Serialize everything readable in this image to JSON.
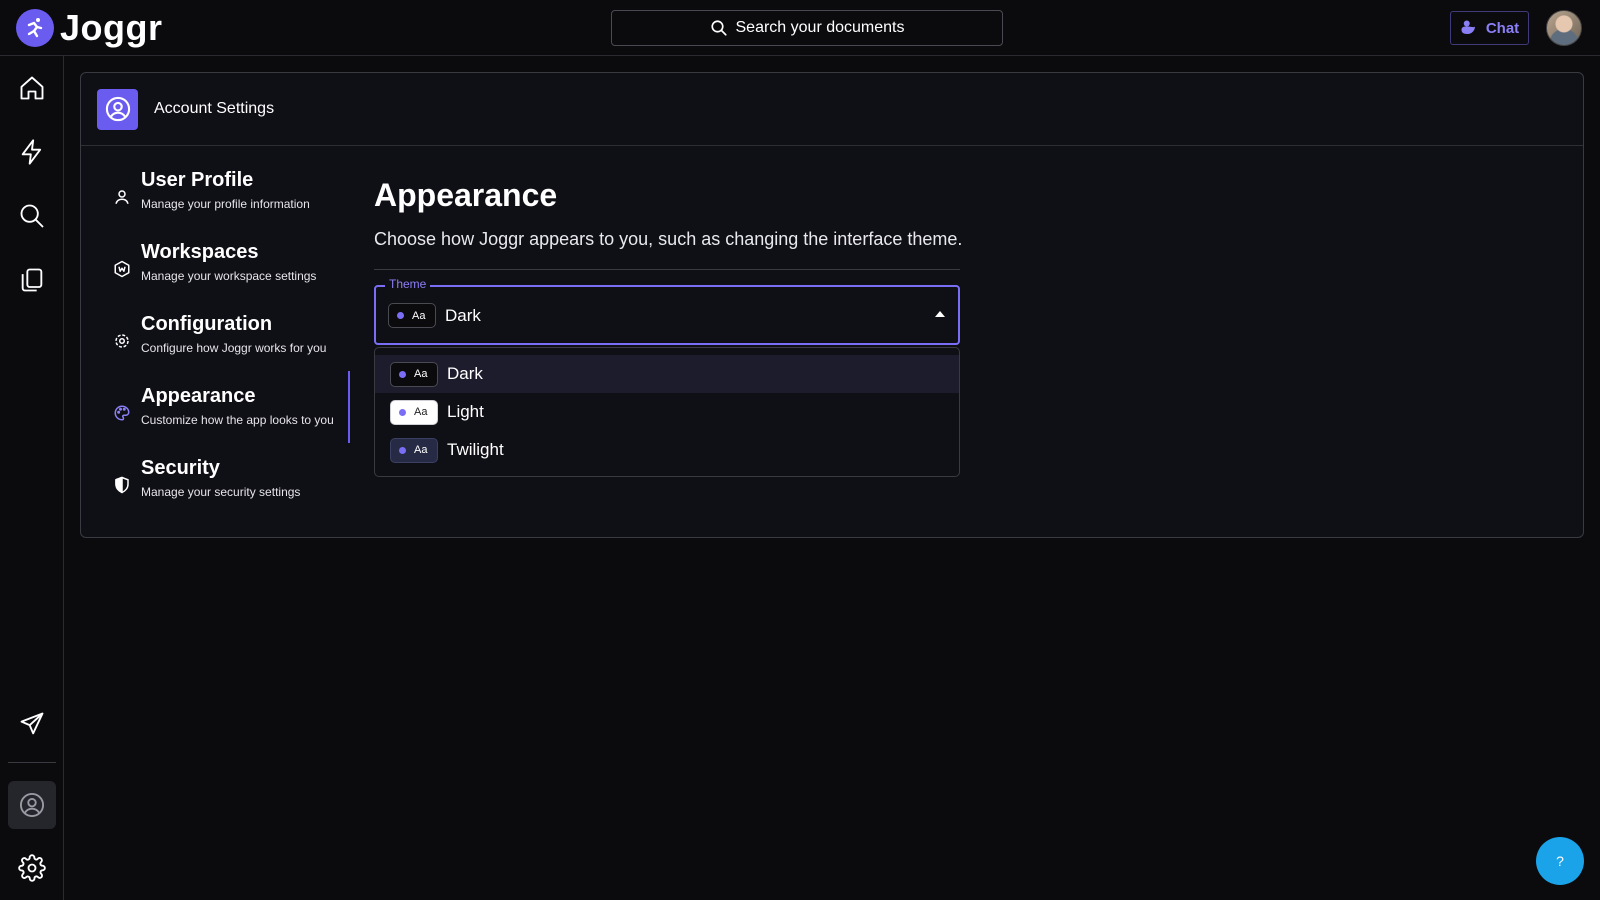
{
  "app": {
    "name": "Joggr"
  },
  "search": {
    "placeholder": "Search your documents"
  },
  "header": {
    "chat_label": "Chat"
  },
  "rail": {
    "items": [
      "home-icon",
      "lightning-icon",
      "search-icon",
      "documents-icon",
      "send-icon",
      "account-icon",
      "settings-icon"
    ]
  },
  "panel": {
    "title": "Account Settings"
  },
  "settings_nav": [
    {
      "title": "User Profile",
      "subtitle": "Manage your profile information"
    },
    {
      "title": "Workspaces",
      "subtitle": "Manage your workspace settings"
    },
    {
      "title": "Configuration",
      "subtitle": "Configure how Joggr works for you"
    },
    {
      "title": "Appearance",
      "subtitle": "Customize how the app looks to you"
    },
    {
      "title": "Security",
      "subtitle": "Manage your security settings"
    }
  ],
  "appearance": {
    "title": "Appearance",
    "description": "Choose how Joggr appears to you, such as changing the interface theme.",
    "theme_label": "Theme",
    "selected_theme": "Dark",
    "chip_text": "Aa",
    "options": [
      "Dark",
      "Light",
      "Twilight"
    ]
  },
  "help": {
    "label": "?"
  },
  "colors": {
    "accent": "#6b5cf0",
    "help": "#1aa3e8",
    "background": "#0b0b0e"
  }
}
